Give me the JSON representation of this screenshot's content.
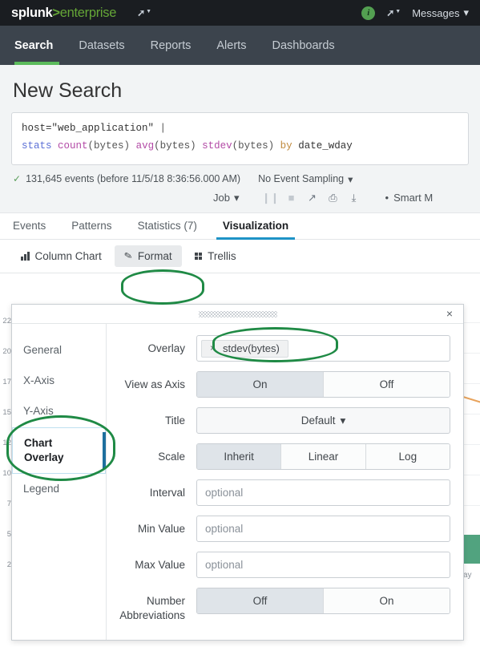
{
  "topbar": {
    "logo_splunk": "splunk",
    "logo_gt": ">",
    "logo_enterprise": "enterprise",
    "app_nav_icon": "arrow-dropdown-icon",
    "info_badge": "i",
    "secondary_icon": "arrow-dropdown-icon",
    "messages_label": "Messages",
    "messages_caret": "▾"
  },
  "nav": {
    "items": [
      {
        "label": "Search",
        "active": true
      },
      {
        "label": "Datasets",
        "active": false
      },
      {
        "label": "Reports",
        "active": false
      },
      {
        "label": "Alerts",
        "active": false
      },
      {
        "label": "Dashboards",
        "active": false
      }
    ]
  },
  "page": {
    "title": "New Search"
  },
  "search": {
    "line1_host": "host=\"web_application\"",
    "line1_pipe": "|",
    "cmd_stats": "stats",
    "fn_count": "count",
    "arg_count": "(bytes)",
    "fn_avg": "avg",
    "arg_avg": "(bytes)",
    "fn_stdev": "stdev",
    "arg_stdev": "(bytes)",
    "kw_by": "by",
    "field_by": "date_wday"
  },
  "results": {
    "check_icon": "✓",
    "events_text": "131,645 events (before 11/5/18 8:36:56.000 AM)",
    "sampling_label": "No Event Sampling",
    "sampling_caret": "▾",
    "job_label": "Job",
    "job_caret": "▾",
    "pause_icon": "❙❙",
    "stop_icon": "■",
    "share_icon": "↗",
    "print_icon": "⎙",
    "export_icon": "⤓",
    "smart_icon": "•",
    "smart_label": "Smart M"
  },
  "tabs": [
    {
      "label": "Events",
      "active": false
    },
    {
      "label": "Patterns",
      "active": false
    },
    {
      "label": "Statistics (7)",
      "active": false
    },
    {
      "label": "Visualization",
      "active": true
    }
  ],
  "vizbar": {
    "chart_type_label": "Column Chart",
    "chart_type_icon": "bar-chart-icon",
    "format_label": "Format",
    "format_icon": "pencil-icon",
    "trellis_label": "Trellis",
    "trellis_icon": "grid-icon"
  },
  "dialog": {
    "close_icon": "×",
    "drag_handle": "drag-grip",
    "sidebar": [
      {
        "label": "General",
        "active": false
      },
      {
        "label": "X-Axis",
        "active": false
      },
      {
        "label": "Y-Axis",
        "active": false
      },
      {
        "label": "Chart Overlay",
        "active": true
      },
      {
        "label": "Legend",
        "active": false
      }
    ],
    "fields": {
      "overlay": {
        "label": "Overlay",
        "token_text": "stdev(bytes)",
        "token_remove_icon": "×"
      },
      "view_as_axis": {
        "label": "View as Axis",
        "options": [
          "On",
          "Off"
        ],
        "selected": "On"
      },
      "title": {
        "label": "Title",
        "value": "Default",
        "caret": "▾"
      },
      "scale": {
        "label": "Scale",
        "options": [
          "Inherit",
          "Linear",
          "Log"
        ],
        "selected": "Inherit"
      },
      "interval": {
        "label": "Interval",
        "value": "",
        "placeholder": "optional"
      },
      "min_value": {
        "label": "Min Value",
        "value": "",
        "placeholder": "optional"
      },
      "max_value": {
        "label": "Max Value",
        "value": "",
        "placeholder": "optional"
      },
      "number_abbreviations": {
        "label": "Number Abbreviations",
        "options": [
          "Off",
          "On"
        ],
        "selected": "Off"
      }
    }
  },
  "chart_behind": {
    "y_tick_fragments": [
      "22",
      "20",
      "17",
      "15",
      "12",
      "10",
      "7",
      "5",
      "2"
    ],
    "x_label_fragment": "ay",
    "overlay_line_color": "#e8a35c",
    "column_color": "#51a37f"
  },
  "annotations": {
    "color": "#1f8a45",
    "targets": [
      "format-button",
      "chart-overlay-sidebar-item",
      "overlay-token-field"
    ]
  }
}
